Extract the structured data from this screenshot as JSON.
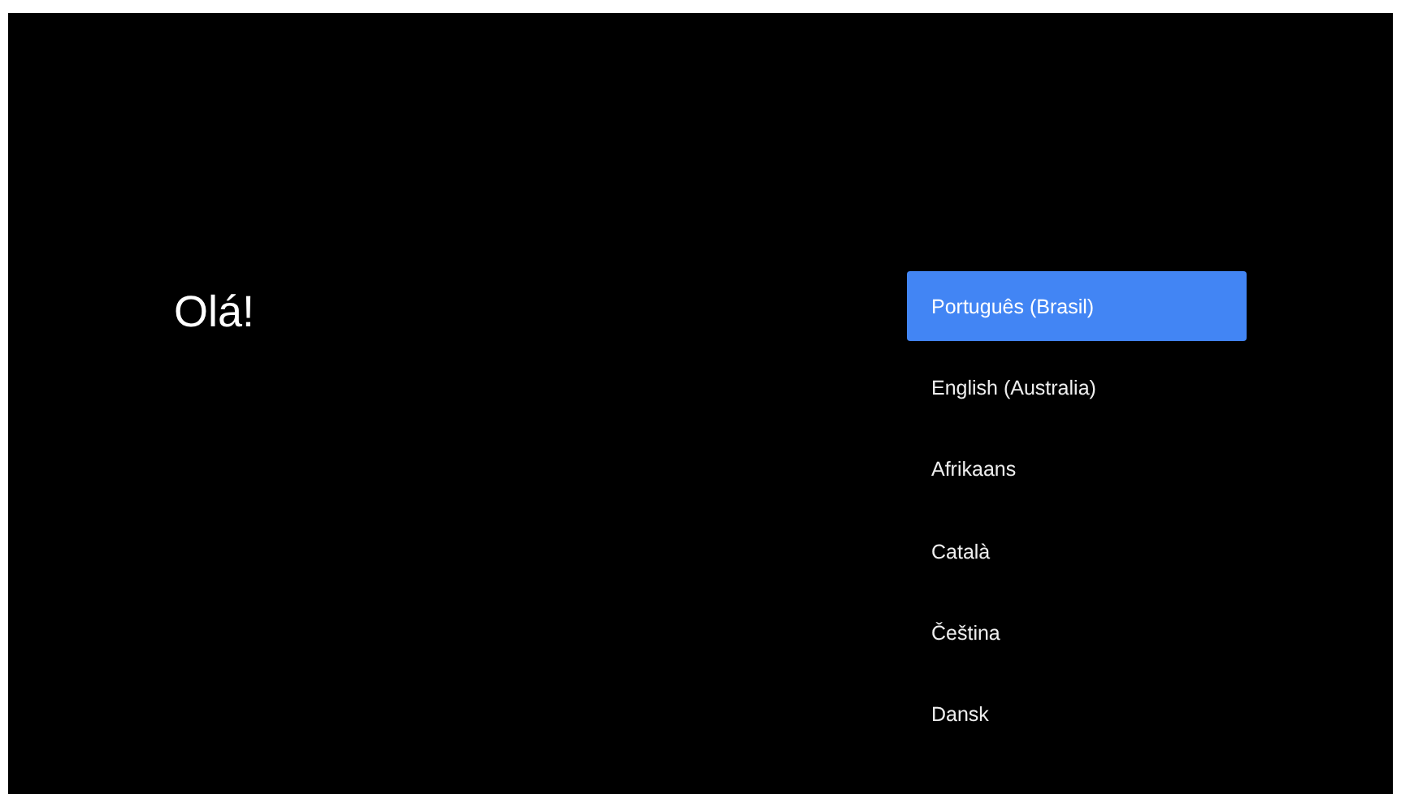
{
  "greeting": "Olá!",
  "languages": [
    {
      "label": "Português (Brasil)",
      "selected": true
    },
    {
      "label": "English (Australia)",
      "selected": false
    },
    {
      "label": "Afrikaans",
      "selected": false
    },
    {
      "label": "Català",
      "selected": false
    },
    {
      "label": "Čeština",
      "selected": false
    },
    {
      "label": "Dansk",
      "selected": false
    }
  ]
}
